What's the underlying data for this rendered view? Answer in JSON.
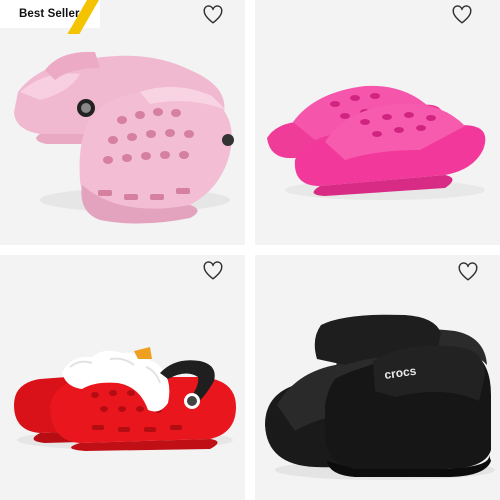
{
  "grid": {
    "products": [
      {
        "badge": "Best Seller",
        "image": "pink-classic-clog",
        "color": "#f2b8d0",
        "favorite_icon": "heart-outline-icon"
      },
      {
        "image": "hot-pink-slide",
        "color": "#f2389a",
        "favorite_icon": "heart-outline-icon"
      },
      {
        "image": "red-lined-clog",
        "color": "#e8161e",
        "favorite_icon": "heart-outline-icon"
      },
      {
        "image": "black-cozy-sandal",
        "logo": "crocs",
        "color": "#161616",
        "favorite_icon": "heart-outline-icon"
      }
    ]
  },
  "colors": {
    "badge_accent": "#f5c400",
    "card_background": "#f3f3f3"
  }
}
